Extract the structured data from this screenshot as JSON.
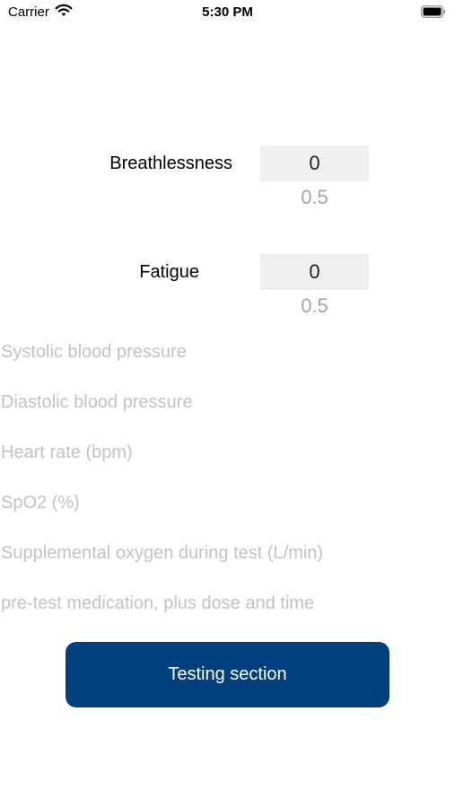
{
  "status_bar": {
    "carrier": "Carrier",
    "time": "5:30 PM"
  },
  "scales": [
    {
      "label": "Breathlessness",
      "value": "0",
      "next_value": "0.5"
    },
    {
      "label": "Fatigue",
      "value": "0",
      "next_value": "0.5"
    }
  ],
  "fields": {
    "systolic": {
      "placeholder": "Systolic blood pressure",
      "value": ""
    },
    "diastolic": {
      "placeholder": "Diastolic blood pressure",
      "value": ""
    },
    "heart_rate": {
      "placeholder": "Heart rate (bpm)",
      "value": ""
    },
    "spo2": {
      "placeholder": "SpO2 (%)",
      "value": ""
    },
    "oxygen": {
      "placeholder": "Supplemental oxygen during test (L/min)",
      "value": ""
    },
    "medication": {
      "placeholder": "pre-test medication, plus dose and time",
      "value": ""
    }
  },
  "actions": {
    "testing_section_label": "Testing section"
  },
  "colors": {
    "button_bg": "#00407e",
    "placeholder": "#c3c3c7",
    "picker_bg": "#efefef"
  }
}
